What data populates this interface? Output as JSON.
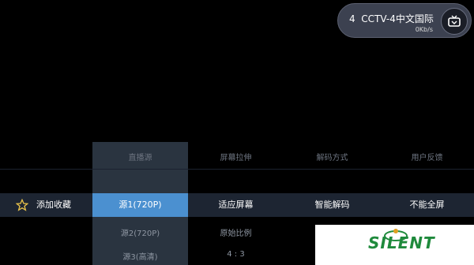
{
  "channel": {
    "number": "4",
    "name": "CCTV-4中文国际",
    "rate": "0Kb/s"
  },
  "menu": {
    "headers": [
      "直播源",
      "屏幕拉伸",
      "解码方式",
      "用户反馈"
    ],
    "favorite_label": "添加收藏",
    "row": {
      "source": "源1(720P)",
      "stretch": "适应屏幕",
      "decode": "智能解码",
      "feedback": "不能全屏"
    },
    "source_options": [
      "源2(720P)",
      "源3(高清)"
    ],
    "stretch_options": [
      "原始比例",
      "4 : 3"
    ]
  },
  "watermark": {
    "text": "SILENT"
  },
  "colors": {
    "accent": "#4b90d0",
    "column_bg": "#2a3440",
    "badge_bg": "#3c4150"
  }
}
